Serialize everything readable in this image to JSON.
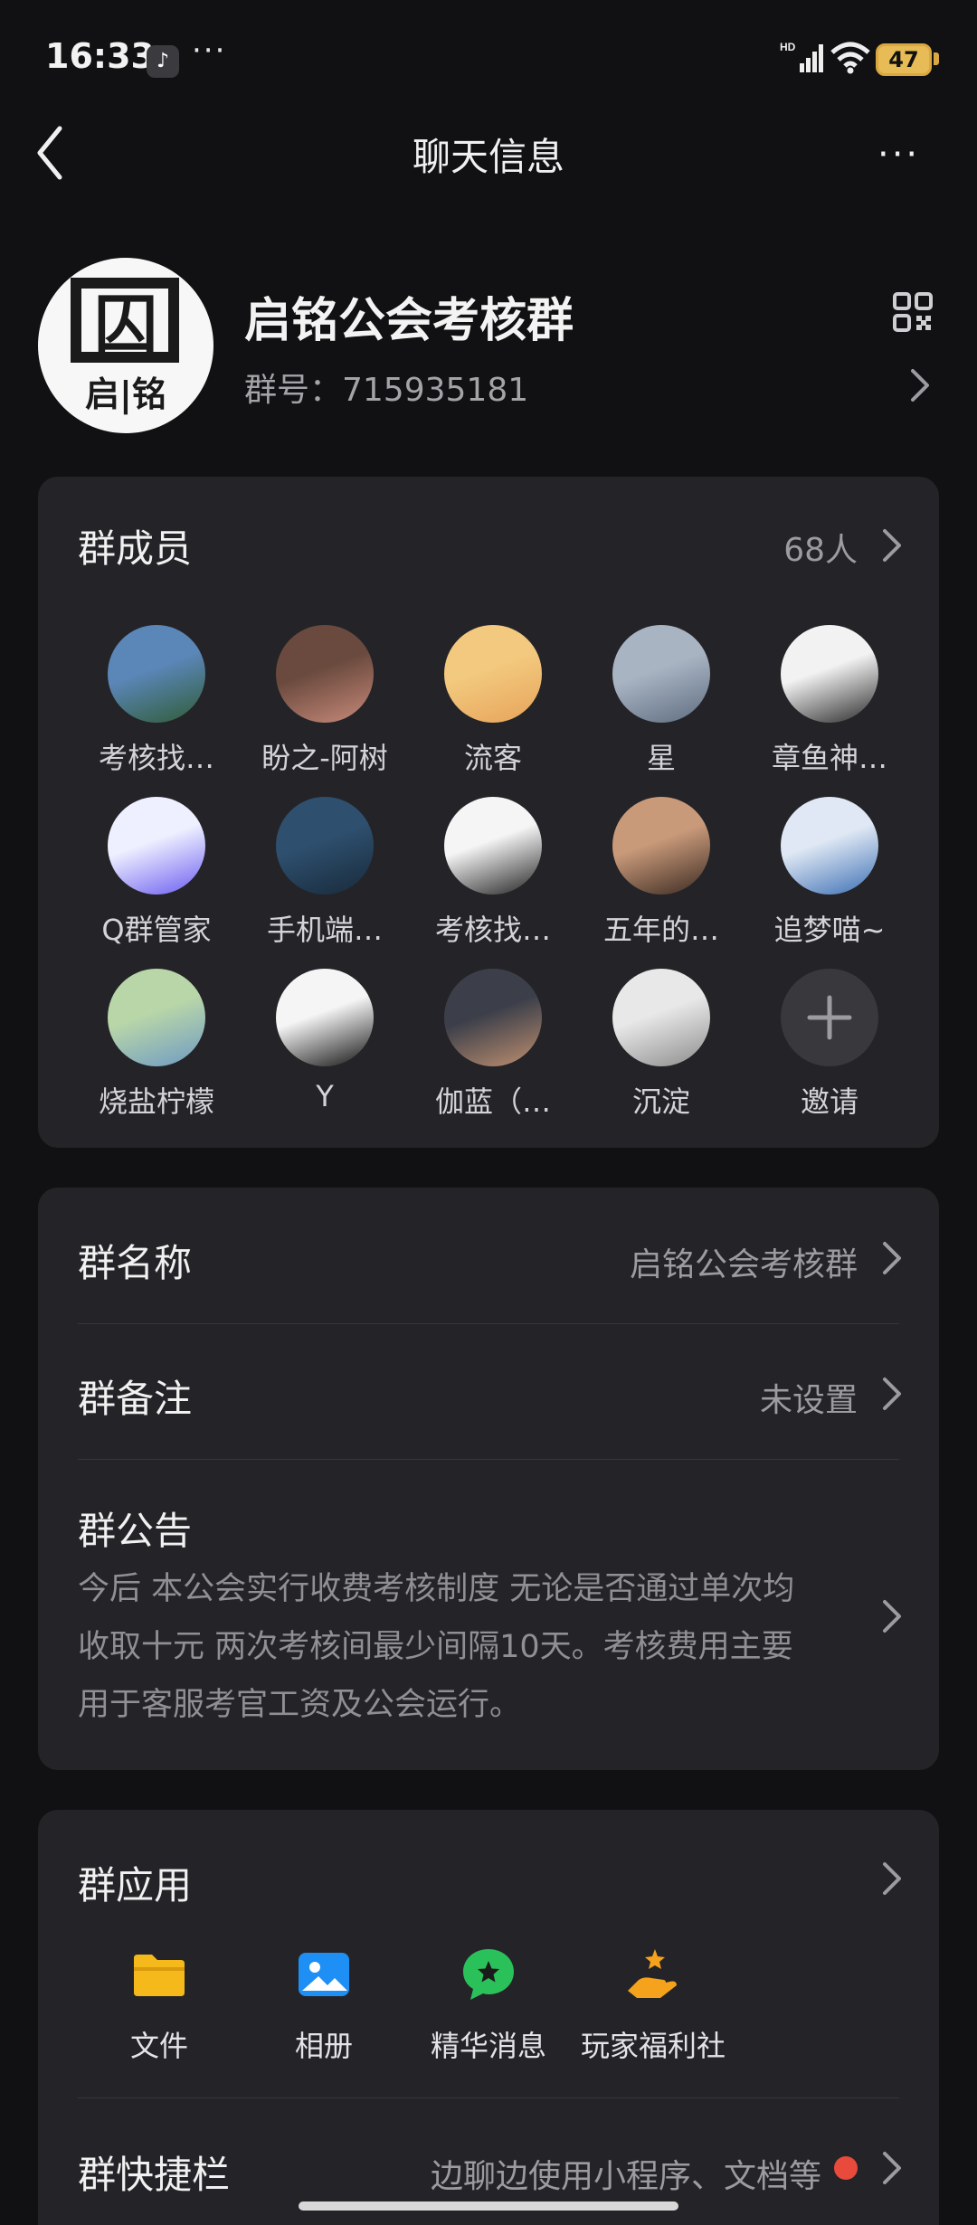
{
  "status": {
    "time": "16:33",
    "app_glyph": "♪",
    "dots": "···",
    "network": "HD",
    "battery": "47"
  },
  "nav": {
    "title": "聊天信息",
    "more": "···"
  },
  "group": {
    "name": "启铭公会考核群",
    "id_label": "群号：715935181",
    "avatar_text_top": "囚",
    "avatar_text_bottom": "启|铭"
  },
  "members": {
    "title": "群成员",
    "count": "68人",
    "list": [
      {
        "name": "考核找…",
        "colors": [
          "#5b86b8",
          "#2f5c36"
        ]
      },
      {
        "name": "盼之-阿树",
        "colors": [
          "#6a4a3e",
          "#c88a7a"
        ]
      },
      {
        "name": "流客",
        "colors": [
          "#f2c97e",
          "#e7a35a"
        ]
      },
      {
        "name": "星",
        "colors": [
          "#a9b4c3",
          "#5e6d80"
        ]
      },
      {
        "name": "章鱼神…",
        "colors": [
          "#f2f2f2",
          "#2a2a2a"
        ]
      },
      {
        "name": "Q群管家",
        "colors": [
          "#eef0ff",
          "#6b5cf0"
        ]
      },
      {
        "name": "手机端…",
        "colors": [
          "#2e4f6e",
          "#182a3a"
        ]
      },
      {
        "name": "考核找…",
        "colors": [
          "#f5f5f5",
          "#222222"
        ]
      },
      {
        "name": "五年的…",
        "colors": [
          "#c99a7a",
          "#3b2a22"
        ]
      },
      {
        "name": "追梦喵~",
        "colors": [
          "#dfe8f4",
          "#3c6fb4"
        ]
      },
      {
        "name": "烧盐柠檬",
        "colors": [
          "#b8d6a8",
          "#6e9ac4"
        ]
      },
      {
        "name": "Y",
        "colors": [
          "#f5f5f5",
          "#111111"
        ]
      },
      {
        "name": "伽蓝（…",
        "colors": [
          "#3c3f4a",
          "#c09070"
        ]
      },
      {
        "name": "沉淀",
        "colors": [
          "#e8e8e8",
          "#8c8c8c"
        ]
      },
      {
        "name": "邀请",
        "colors": [
          "#38383d",
          "#38383d"
        ]
      }
    ]
  },
  "info": {
    "name_label": "群名称",
    "name_value": "启铭公会考核群",
    "remark_label": "群备注",
    "remark_value": "未设置",
    "notice_label": "群公告",
    "notice_lines": [
      "今后 本公会实行收费考核制度 无论是否通过单次均",
      "收取十元 两次考核间最少间隔10天。考核费用主要",
      "用于客服考官工资及公会运行。"
    ]
  },
  "apps": {
    "title": "群应用",
    "items": [
      {
        "label": "文件",
        "icon": "folder-icon",
        "color": "#f5b91c"
      },
      {
        "label": "相册",
        "icon": "photo-icon",
        "color": "#1e8ff5"
      },
      {
        "label": "精华消息",
        "icon": "star-bubble-icon",
        "color": "#2bc15a"
      },
      {
        "label": "玩家福利社",
        "icon": "gift-hand-icon",
        "color": "#f5a21c"
      }
    ],
    "shortcut_label": "群快捷栏",
    "shortcut_value": "边聊边使用小程序、文档等"
  },
  "colors": {
    "background": "#111113",
    "card": "#242428",
    "secondary_text": "#9b9ba0",
    "alert": "#e84a3c"
  }
}
